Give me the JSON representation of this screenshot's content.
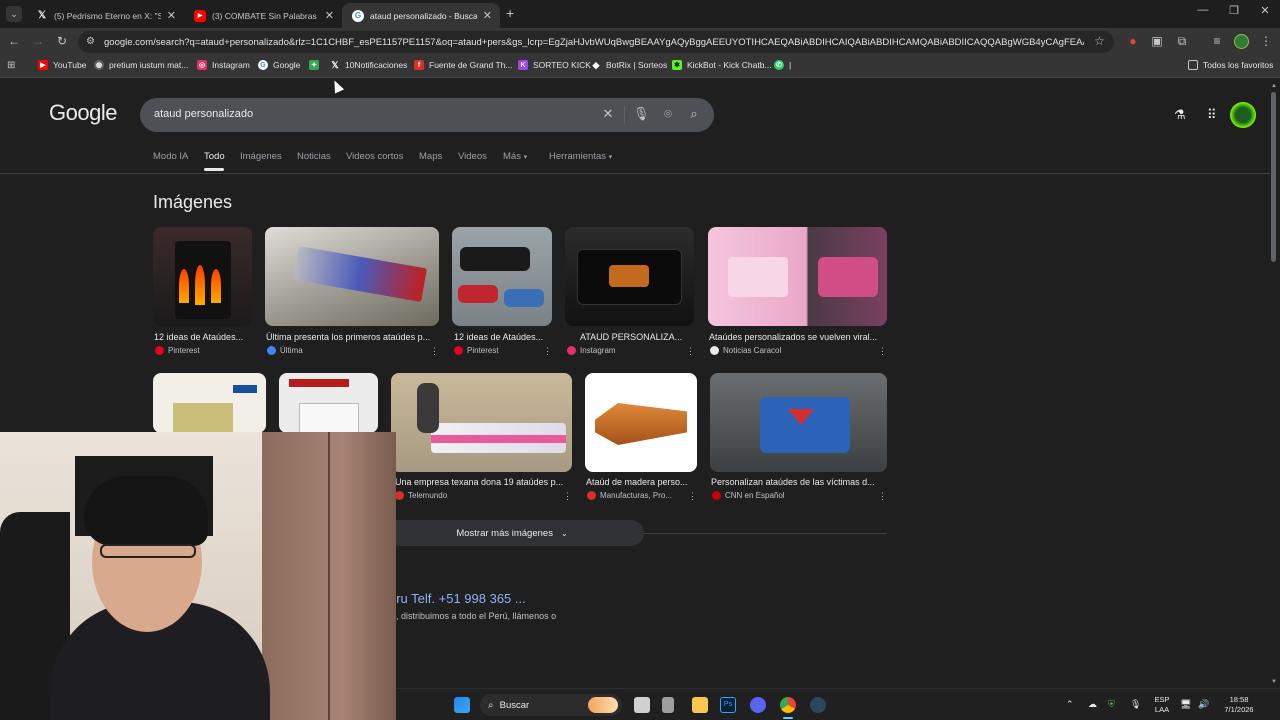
{
  "browser": {
    "tabs": [
      {
        "title": "(5) Pedrismo Eterno en X: \"Sha",
        "icon": "x-icon"
      },
      {
        "title": "(3) COMBATE Sin Palabras Com",
        "icon": "youtube-icon"
      },
      {
        "title": "ataud personalizado - Buscar c",
        "icon": "google-icon"
      }
    ],
    "url": "google.com/search?q=ataud+personalizado&rlz=1C1CHBF_esPE1157PE1157&oq=ataud+pers&gs_lcrp=EgZjaHJvbWUqBwgBEAAYgAQyBggAEEUYOTIHCAEQABiABDIHCAIQABiABDIHCAMQABiABDIICAQQABgWGB4yCAgFEAAYFhgeMggI...",
    "bookmarks": [
      {
        "label": "YouTube",
        "color": "#ff0000"
      },
      {
        "label": "pretium iustum mat...",
        "color": "#e8eaed"
      },
      {
        "label": "Instagram",
        "color": "#e1306c"
      },
      {
        "label": "Google",
        "color": "#e8eaed"
      },
      {
        "label": "",
        "color": "#34a853"
      },
      {
        "label": "10Notificaciones",
        "color": "#e8eaed"
      },
      {
        "label": "Fuente de Grand Th...",
        "color": "#d93025"
      },
      {
        "label": "SORTEO KICK",
        "color": "#a142f4"
      },
      {
        "label": "BotRix | Sorteos",
        "color": "#e8eaed"
      },
      {
        "label": "KickBot - Kick Chatb...",
        "color": "#53fc18"
      },
      {
        "label": "|",
        "color": "#25d366"
      }
    ],
    "all_bookmarks": "Todos los favoritos"
  },
  "google": {
    "logo": "Google",
    "query": "ataud personalizado",
    "nav": [
      "Modo IA",
      "Todo",
      "Imágenes",
      "Noticias",
      "Videos cortos",
      "Maps",
      "Videos",
      "Más",
      "Herramientas"
    ],
    "active_nav": "Todo",
    "images_heading": "Imágenes",
    "images_row1": [
      {
        "caption": "12 ideas de Ataúdes...",
        "source": "Pinterest",
        "src_color": "#e60023"
      },
      {
        "caption": "Última presenta los primeros ataúdes p...",
        "source": "Última",
        "src_color": "#4285f4"
      },
      {
        "caption": "12 ideas de Ataúdes...",
        "source": "Pinterest",
        "src_color": "#e60023"
      },
      {
        "caption": "ATAUD PERSONALIZA...",
        "source": "Instagram",
        "src_color": "#e1306c"
      },
      {
        "caption": "Ataúdes personalizados se vuelven viral...",
        "source": "Noticias Caracol",
        "src_color": "#e8eaed"
      }
    ],
    "images_row2": [
      {
        "caption": "Una empresa texana dona 19 ataúdes p...",
        "source": "Telemundo",
        "src_color": "#d93025"
      },
      {
        "caption": "Ataúd de madera perso...",
        "source": "Manufacturas, Pro...",
        "src_color": "#d93025"
      },
      {
        "caption": "Personalizan ataúdes de las víctimas d...",
        "source": "CNN en Español",
        "src_color": "#cc0000"
      }
    ],
    "show_more": "Mostrar más imágenes",
    "result_title": "eru Telf. +51 998 365 ...",
    "result_snippet": ", distribuimos a todo el Perú, llámenos o"
  },
  "taskbar": {
    "search": "Buscar",
    "lang_top": "ESP",
    "lang_bottom": "LAA",
    "time": "18:58",
    "date": "7/1/2026"
  }
}
